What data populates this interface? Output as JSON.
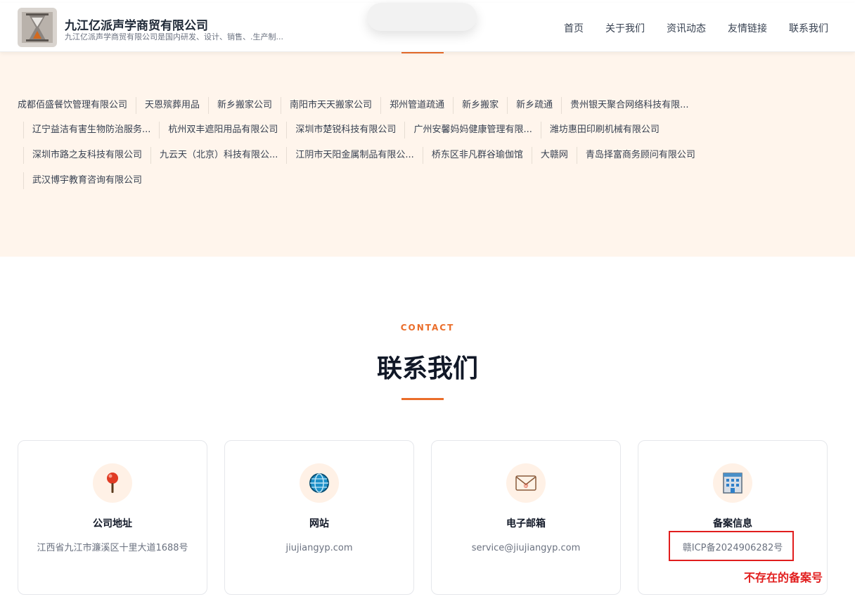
{
  "header": {
    "title": "九江亿派声学商贸有限公司",
    "description": "九江亿派声学商贸有限公司是国内研发、设计、销售、.生产制...",
    "nav": [
      "首页",
      "关于我们",
      "资讯动态",
      "友情链接",
      "联系我们"
    ]
  },
  "links": {
    "rows": [
      [
        "成都佰盛餐饮管理有限公司",
        "天恩殡葬用品",
        "新乡搬家公司",
        "南阳市天天搬家公司",
        "郑州管道疏通",
        "新乡搬家",
        "新乡疏通",
        "贵州银天聚合网络科技有限..."
      ],
      [
        "辽宁益洁有害生物防治服务...",
        "杭州双丰遮阳用品有限公司",
        "深圳市楚锐科技有限公司",
        "广州安馨妈妈健康管理有限...",
        "潍坊惠田印刷机械有限公司"
      ],
      [
        "深圳市路之友科技有限公司",
        "九云天（北京）科技有限公...",
        "江阴市天阳金属制品有限公...",
        "桥东区非凡群谷瑜伽馆",
        "大赣网",
        "青岛择富商务顾问有限公司"
      ],
      [
        "武汉博宇教育咨询有限公司"
      ]
    ]
  },
  "contact": {
    "eyebrow": "CONTACT",
    "title": "联系我们",
    "cards": [
      {
        "icon": "pushpin-icon",
        "title": "公司地址",
        "value": "江西省九江市濂溪区十里大道1688号"
      },
      {
        "icon": "globe-icon",
        "title": "网站",
        "value": "jiujiangyp.com"
      },
      {
        "icon": "email-icon",
        "title": "电子邮箱",
        "value": "service@jiujiangyp.com"
      },
      {
        "icon": "building-icon",
        "title": "备案信息",
        "value": "赣ICP备2024906282号"
      }
    ]
  },
  "annotation": {
    "text": "不存在的备案号"
  },
  "colors": {
    "accent": "#ea6d2a",
    "band_bg": "#fff5ec",
    "annotation_red": "#e11d1d"
  }
}
